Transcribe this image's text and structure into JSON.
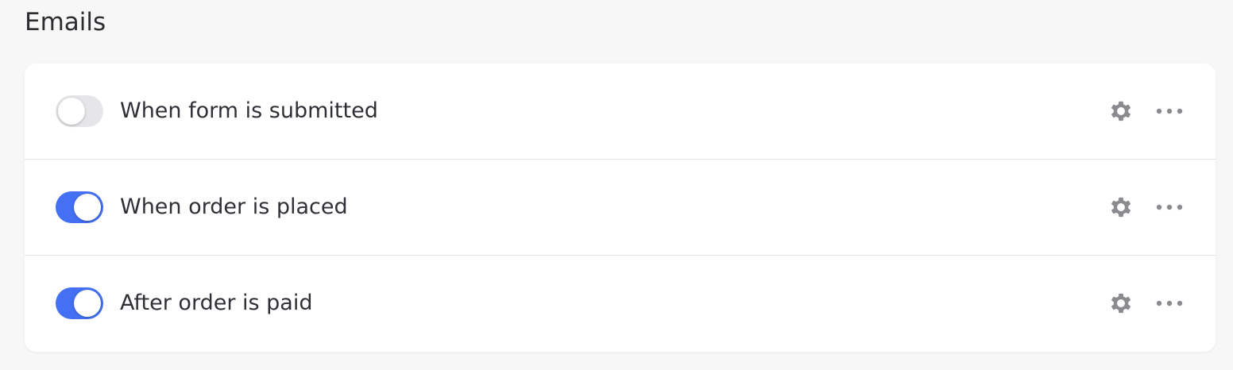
{
  "section": {
    "title": "Emails"
  },
  "rows": [
    {
      "label": "When form is submitted",
      "enabled": false
    },
    {
      "label": "When order is placed",
      "enabled": true
    },
    {
      "label": "After order is paid",
      "enabled": true
    }
  ],
  "icons": {
    "settings": "gear-icon",
    "more": "more-horizontal-icon"
  },
  "colors": {
    "toggle_on": "#4470f4",
    "toggle_off": "#e6e6e9",
    "icon": "#8a8a8f"
  }
}
